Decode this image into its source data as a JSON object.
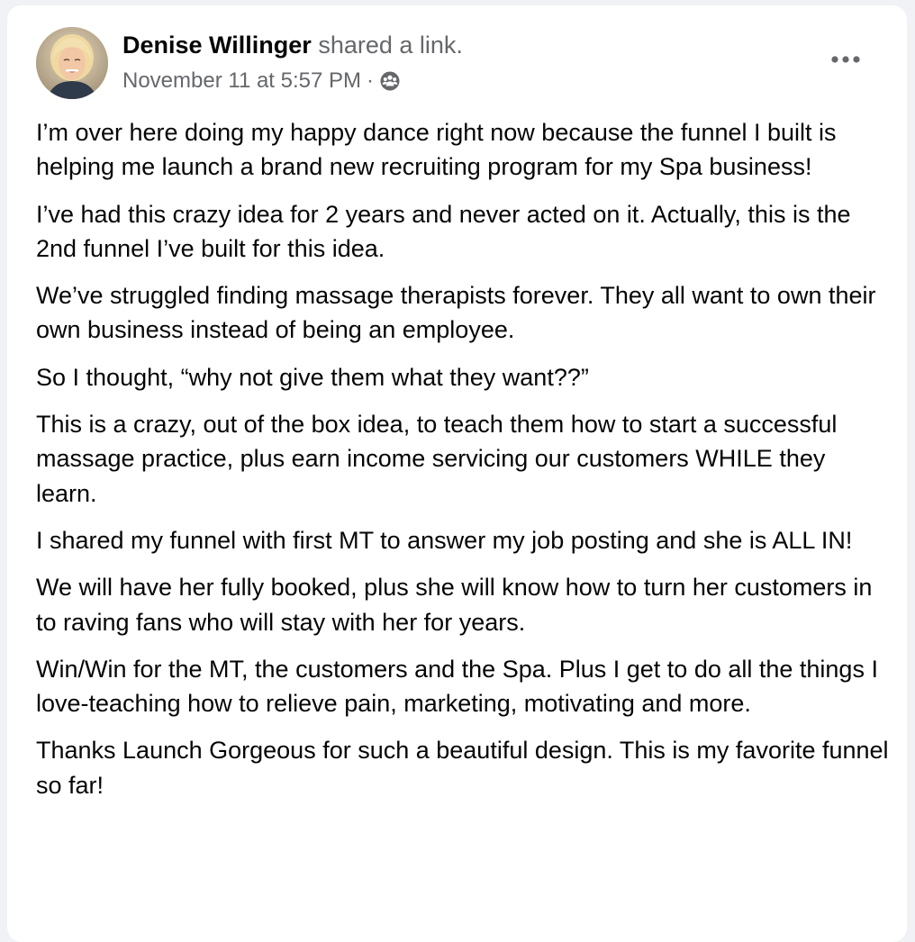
{
  "post": {
    "author": "Denise Willinger",
    "action": "shared a link.",
    "timestamp": "November 11 at 5:57 PM",
    "separator": "·",
    "audience_icon": "friends-icon",
    "more_icon": "more-dots-icon",
    "paragraphs": [
      "I’m over here doing my happy dance right now because the funnel I built is helping me launch a brand new recruiting program for my Spa business!",
      "I’ve had this crazy idea for 2 years and never acted on it. Actually, this is the 2nd funnel I’ve built for this idea.",
      "We’ve struggled finding massage therapists forever. They all want to own their own business instead of being an employee.",
      "So I thought, “why not give them what they want??”",
      "This is a crazy, out of the box idea, to teach them how to start a successful massage practice, plus earn income servicing our customers WHILE they learn.",
      "I shared my funnel with first MT to answer my job posting and she is ALL IN!",
      "We will have her fully booked, plus she will know how to turn her customers in to raving fans who will stay with her for years.",
      "Win/Win for the MT, the customers and the Spa. Plus I get to do all the things I love-teaching how to relieve pain, marketing, motivating and more.",
      "Thanks Launch Gorgeous for such a beautiful design. This is my favorite funnel so far!"
    ]
  },
  "colors": {
    "page_background": "#f0f2f5",
    "card_background": "#ffffff",
    "primary_text": "#050505",
    "secondary_text": "#65676b"
  }
}
